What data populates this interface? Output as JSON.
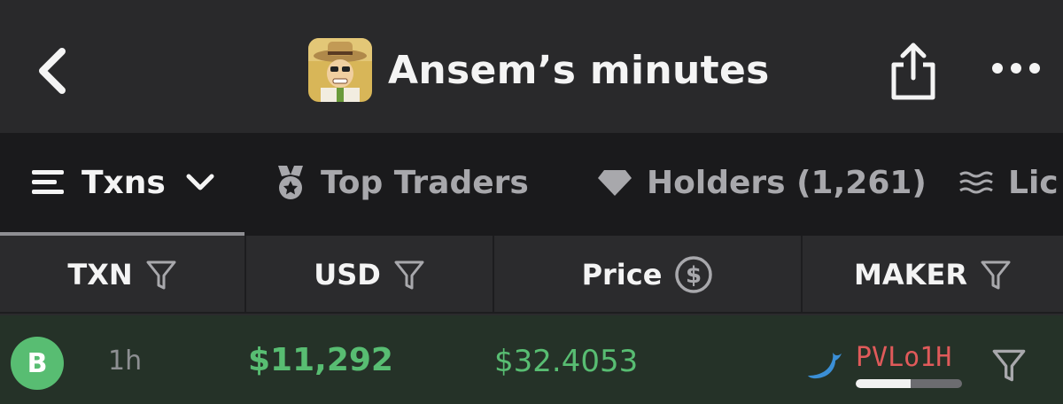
{
  "header": {
    "title": "Ansem’s minutes",
    "avatar_icon": "cartoon-character-avatar",
    "back_icon": "chevron-left-icon",
    "share_icon": "share-icon",
    "more_icon": "more-horizontal-icon"
  },
  "tabs": [
    {
      "label": "Txns",
      "icon": "list-icon",
      "active": true
    },
    {
      "label": "Top Traders",
      "icon": "medal-icon",
      "active": false
    },
    {
      "label": "Holders (1,261)",
      "icon": "diamond-icon",
      "active": false
    },
    {
      "label": "Lic",
      "icon": "waves-icon",
      "active": false
    }
  ],
  "columns": [
    {
      "label": "TXN",
      "icon": "filter-icon"
    },
    {
      "label": "USD",
      "icon": "filter-icon"
    },
    {
      "label": "Price",
      "icon": "dollar-circle-icon"
    },
    {
      "label": "MAKER",
      "icon": "filter-icon"
    }
  ],
  "rows": [
    {
      "type": "B",
      "age": "1h",
      "usd": "$11,292",
      "price": "$32.4053",
      "maker": "PVLo1H",
      "maker_icon": "whale-icon",
      "maker_balance_fraction": 0.52,
      "filter_icon": "filter-icon"
    }
  ],
  "colors": {
    "buy_green": "#58bd72",
    "maker_red": "#e05a5a",
    "row_bg": "#253228",
    "tab_bar_bg": "#1a1a1c",
    "header_bg": "#29292b"
  }
}
